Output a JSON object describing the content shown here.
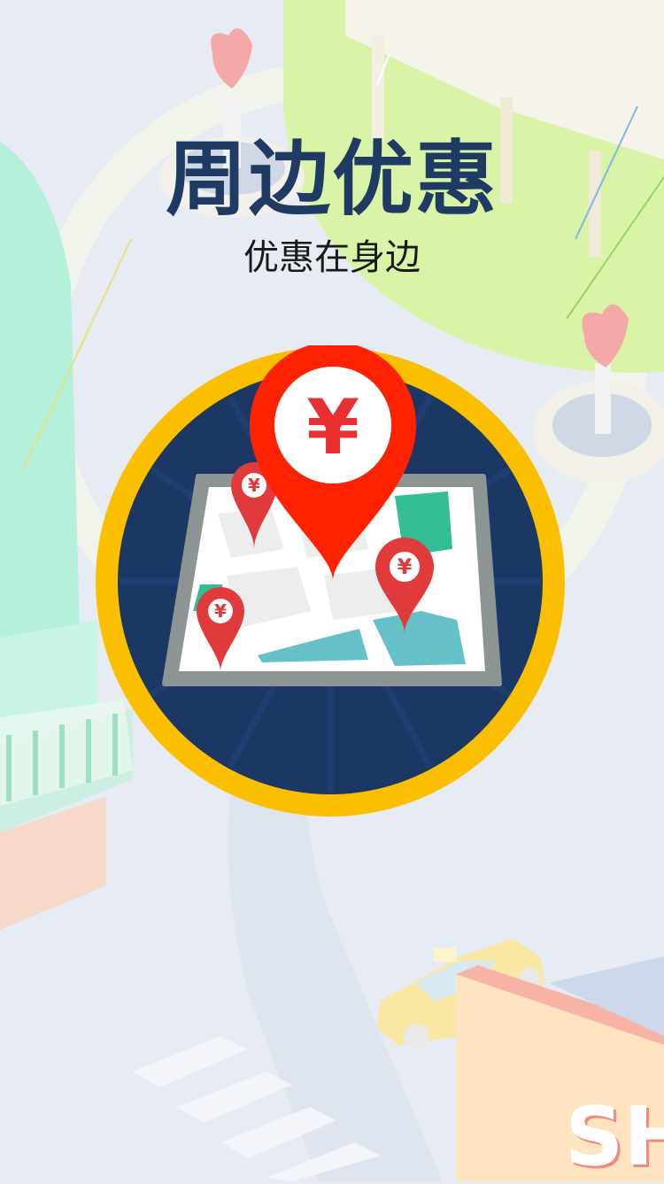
{
  "page": {
    "title": "周边优惠",
    "subtitle": "优惠在身边"
  },
  "badge": {
    "main_pin_symbol": "¥",
    "small_pin_symbols": [
      "¥",
      "¥",
      "¥"
    ]
  },
  "scenery": {
    "sign_text": "SH"
  },
  "colors": {
    "title": "#1f3a63",
    "badge_ring": "#fbbf00",
    "badge_fill": "#1b3763",
    "pin_red": "#ff2200",
    "small_pin_red": "#e03a3a",
    "map_green": "#33bd95",
    "map_water": "#66c0c8"
  }
}
